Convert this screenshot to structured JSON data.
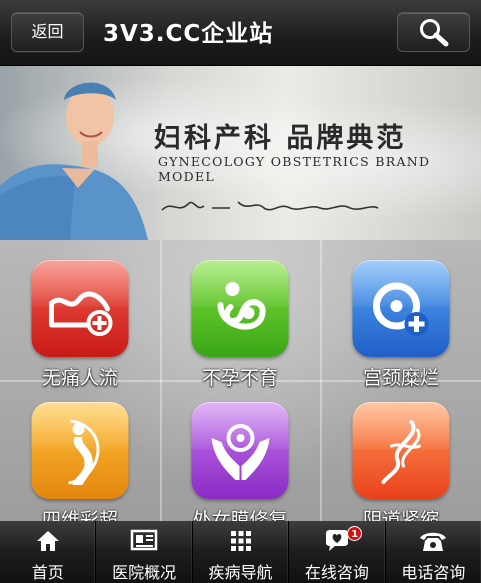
{
  "header": {
    "back_label": "返回",
    "title": "3V3.CC企业站"
  },
  "banner": {
    "title": "妇科产科 品牌典范",
    "subtitle": "GYNECOLOGY OBSTETRICS BRAND MODEL"
  },
  "tiles": [
    {
      "label": "无痛人流",
      "icon": "heart-plus-icon",
      "color": "#e0312a"
    },
    {
      "label": "不孕不育",
      "icon": "mother-child-icon",
      "color": "#4fbf1e"
    },
    {
      "label": "宫颈糜烂",
      "icon": "ring-plus-icon",
      "color": "#2f7fe0"
    },
    {
      "label": "四维彩超",
      "icon": "pregnant-silhouette-icon",
      "color": "#f0a020"
    },
    {
      "label": "处女膜修复",
      "icon": "hands-heart-icon",
      "color": "#a53fd8"
    },
    {
      "label": "阴道紧缩",
      "icon": "ribbon-icon",
      "color": "#ff6a2a"
    }
  ],
  "nav": [
    {
      "label": "首页",
      "icon": "home-icon"
    },
    {
      "label": "医院概况",
      "icon": "news-card-icon"
    },
    {
      "label": "疾病导航",
      "icon": "grid-icon"
    },
    {
      "label": "在线咨询",
      "icon": "chat-heart-icon",
      "badge": "1"
    },
    {
      "label": "电话咨询",
      "icon": "phone-icon"
    }
  ]
}
